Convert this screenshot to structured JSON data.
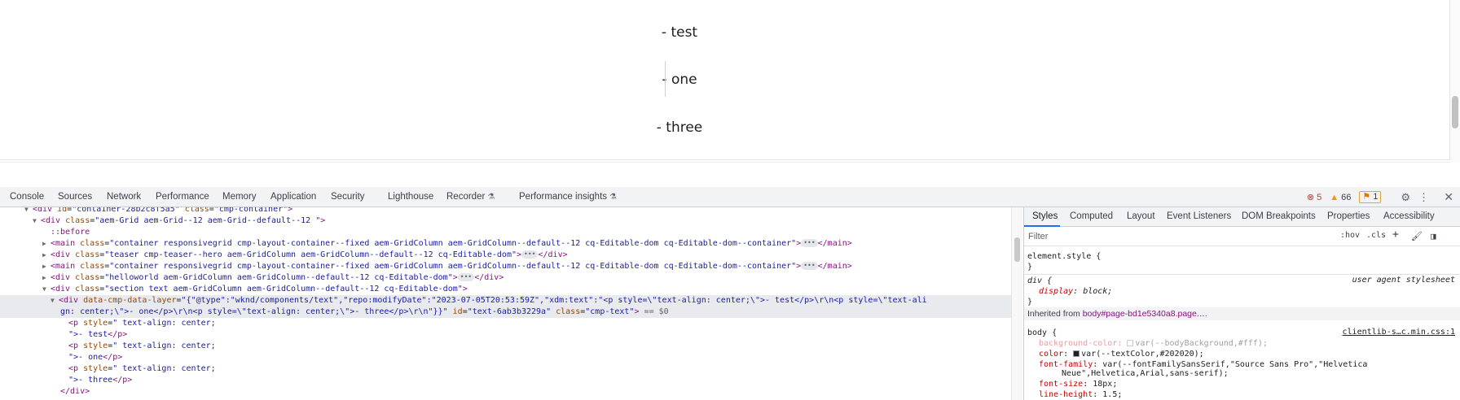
{
  "page": {
    "paragraphs": [
      "- test",
      "- one",
      "- three"
    ]
  },
  "devtools": {
    "tabs": [
      "Console",
      "Sources",
      "Network",
      "Performance",
      "Memory",
      "Application",
      "Security",
      "Lighthouse",
      "Recorder",
      "Performance insights"
    ],
    "status": {
      "errors": "5",
      "warnings": "66",
      "issues": "1"
    },
    "dom_lines": {
      "l0": {
        "tag": "<div",
        "a1n": "id",
        "a1v": "\"container-28b2c8f5a5\"",
        "a2n": "class",
        "a2v": "\"cmp-container\"",
        "close": ">"
      },
      "l1": {
        "tag": "<div",
        "an": "class",
        "av": "\"aem-Grid aem-Grid--12 aem-Grid--default--12 \"",
        "close": ">"
      },
      "l2": {
        "text": "::before"
      },
      "l3": {
        "tag": "<main",
        "an": "class",
        "av": "\"container responsivegrid cmp-layout-container--fixed aem-GridColumn aem-GridColumn--default--12 cq-Editable-dom cq-Editable-dom--container\"",
        "close": ">",
        "end": "</main>"
      },
      "l4": {
        "tag": "<div",
        "an": "class",
        "av": "\"teaser cmp-teaser--hero aem-GridColumn aem-GridColumn--default--12 cq-Editable-dom\"",
        "close": ">",
        "end": "</div>"
      },
      "l5": {
        "tag": "<main",
        "an": "class",
        "av": "\"container responsivegrid cmp-layout-container--fixed aem-GridColumn aem-GridColumn--default--12 cq-Editable-dom cq-Editable-dom--container\"",
        "close": ">",
        "end": "</main>"
      },
      "l6": {
        "tag": "<div",
        "an": "class",
        "av": "\"helloworld aem-GridColumn aem-GridColumn--default--12 cq-Editable-dom\"",
        "close": ">",
        "end": "</div>"
      },
      "l7": {
        "tag": "<div",
        "an": "class",
        "av": "\"section text aem-GridColumn aem-GridColumn--default--12 cq-Editable-dom\"",
        "close": ">"
      },
      "l8": {
        "tag": "<div",
        "an": "data-cmp-data-layer",
        "av": "\"{\"@type\":\"wknd/components/text\",\"repo:modifyDate\":\"2023-07-05T20:53:59Z\",\"xdm:text\":\"<p style=\\\"text-align: center;\\\">- test</p>\\r\\n<p style=\\\"text-ali"
      },
      "l9": {
        "av": "gn: center;\\\">- one</p>\\r\\n<p style=\\\"text-align: center;\\\">- three</p>\\r\\n\"}}\"",
        "a2n": "id",
        "a2v": "\"text-6ab3b3229a\"",
        "a3n": "class",
        "a3v": "\"cmp-text\"",
        "close": ">",
        "eq": "== $0"
      },
      "l10": {
        "tag": "<p",
        "an": "style",
        "av": "\"  text-align: center;"
      },
      "l11": {
        "text": "\">- test",
        "end": "</p>"
      },
      "l12": {
        "tag": "<p",
        "an": "style",
        "av": "\"  text-align: center;"
      },
      "l13": {
        "text": "\">- one",
        "end": "</p>"
      },
      "l14": {
        "tag": "<p",
        "an": "style",
        "av": "\"  text-align: center;"
      },
      "l15": {
        "text": "\">- three",
        "end": "</p>"
      },
      "l16": {
        "end": "</div>"
      }
    }
  },
  "styles_sidebar": {
    "tabs": [
      "Styles",
      "Computed",
      "Layout",
      "Event Listeners",
      "DOM Breakpoints",
      "Properties",
      "Accessibility"
    ],
    "filter_placeholder": "Filter",
    "hov": ":hov",
    "cls": ".cls",
    "element_style": "element.style {",
    "close_brace": "}",
    "div_rule": {
      "selector": "div {",
      "note": "user agent stylesheet",
      "prop": "display",
      "value": "block;"
    },
    "inherited": {
      "prefix": "Inherited from ",
      "ref": "body#page-bd1e5340a8.page.…"
    },
    "body_rule": {
      "selector": "body {",
      "source": "clientlib-s…c.min.css:1",
      "decls": [
        {
          "prop": "background-color",
          "value": "var(--bodyBackground,#fff);"
        },
        {
          "prop": "color",
          "value": "var(--textColor,#202020);"
        },
        {
          "prop": "font-family",
          "value": "var(--fontFamilySansSerif,\"Source Sans Pro\",\"Helvetica"
        },
        {
          "prop": "",
          "value": "Neue\",Helvetica,Arial,sans-serif);"
        },
        {
          "prop": "font-size",
          "value": "18px;"
        },
        {
          "prop": "line-height",
          "value": "1.5;"
        }
      ]
    },
    "colors": {
      "swatch_bg": "#ffffff",
      "swatch_text": "#202020"
    }
  }
}
